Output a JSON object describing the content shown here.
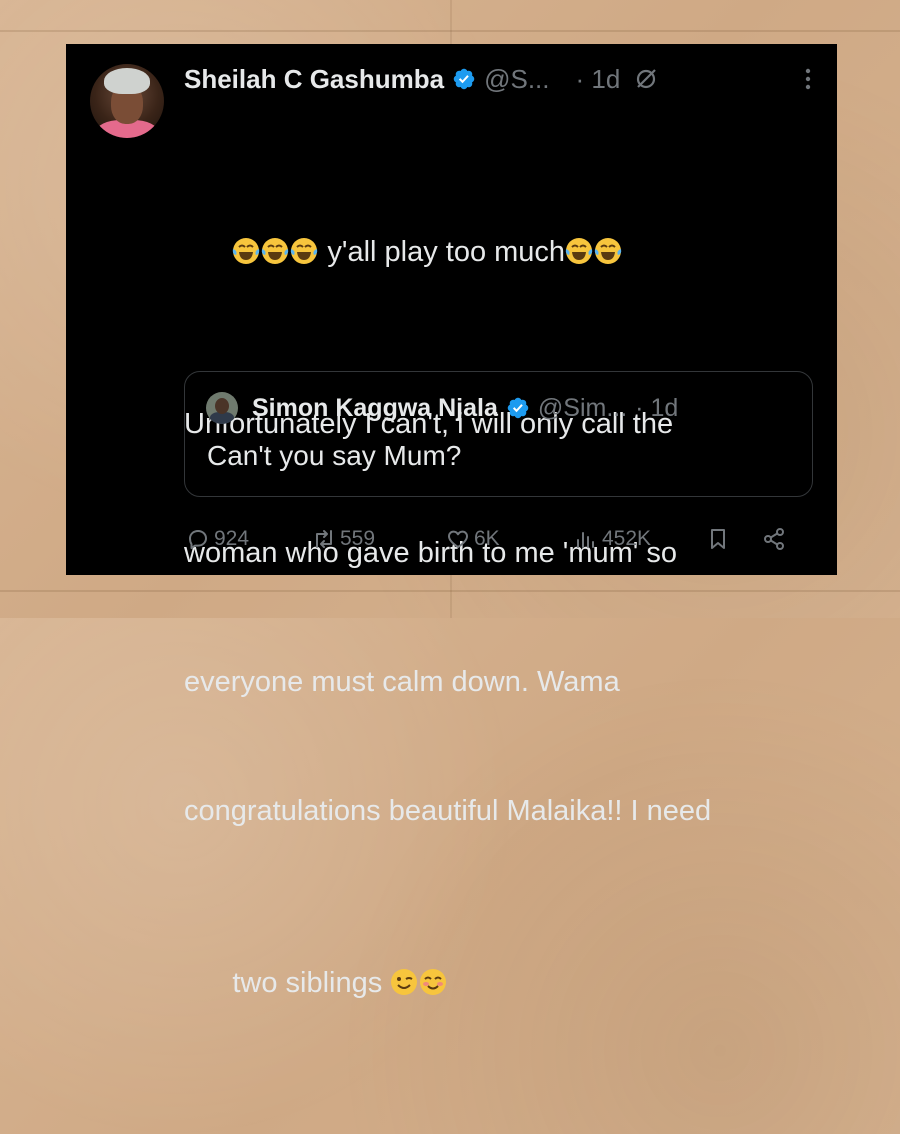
{
  "tweet": {
    "author_name": "Sheilah C Gashumba",
    "handle": "@S...",
    "time": "· 1d",
    "text_lines": [
      " y'all play too much",
      "Unfortunately I can't, i will only call the",
      "woman who gave birth to me 'mum' so",
      "everyone must calm down. Wama",
      "congratulations beautiful Malaika!! I need",
      "two siblings "
    ]
  },
  "quote": {
    "author_name": "Simon Kaggwa Njala",
    "handle": "@Sim...",
    "time": "· 1d",
    "text": "Can't you say Mum?"
  },
  "actions": {
    "replies": "924",
    "reposts": "559",
    "likes": "6K",
    "views": "452K"
  },
  "icons": {
    "verified": "verified-badge-icon",
    "grok": "grok-icon",
    "more": "more-icon",
    "reply": "reply-icon",
    "repost": "repost-icon",
    "like": "heart-icon",
    "views": "views-icon",
    "bookmark": "bookmark-icon",
    "share": "share-icon"
  },
  "colors": {
    "background": "#000000",
    "text": "#e7e9ea",
    "muted": "#71767b",
    "verified": "#1d9bf0"
  }
}
